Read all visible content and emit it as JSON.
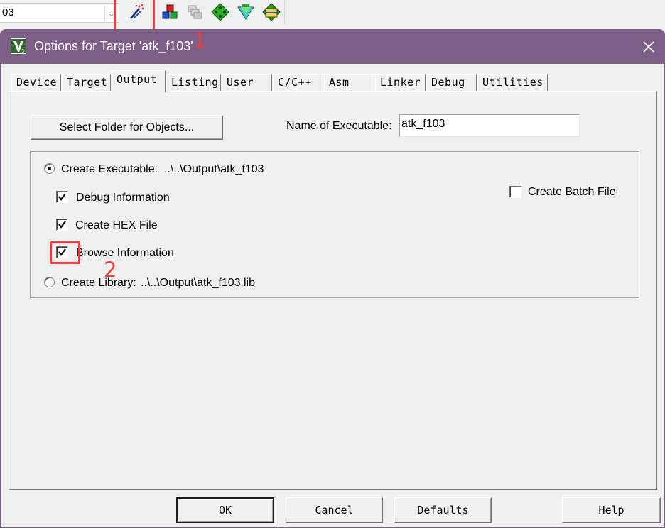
{
  "toolbar": {
    "target_combo_value": "03",
    "annotation_1": "1",
    "icons": [
      "options-for-target-icon",
      "manage-project-items-icon",
      "file-extensions-icon",
      "pack-installer-icon",
      "select-packs-icon",
      "manage-run-time-environment-icon"
    ]
  },
  "dialog": {
    "title": "Options for Target 'atk_f103'",
    "tabs": [
      "Device",
      "Target",
      "Output",
      "Listing",
      "User",
      "C/C++",
      "Asm",
      "Linker",
      "Debug",
      "Utilities"
    ],
    "active_tab": "Output",
    "select_folder_button": "Select Folder for Objects...",
    "name_of_executable_label": "Name of Executable:",
    "name_of_executable_value": "atk_f103",
    "create_executable_label": "Create Executable:",
    "create_executable_path": "..\\..\\Output\\atk_f103",
    "create_executable_selected": true,
    "debug_information_label": "Debug Information",
    "debug_information_checked": true,
    "create_hex_label": "Create HEX File",
    "create_hex_checked": true,
    "browse_information_label": "Browse Information",
    "browse_information_checked": true,
    "create_batch_label": "Create Batch File",
    "create_batch_checked": false,
    "create_library_label": "Create Library:",
    "create_library_path": "..\\..\\Output\\atk_f103.lib",
    "create_library_selected": false,
    "annotation_2": "2",
    "buttons": {
      "ok": "OK",
      "cancel": "Cancel",
      "defaults": "Defaults",
      "help": "Help"
    },
    "colors": {
      "titlebar": "#7c5e86",
      "annotation": "#ef3b3b"
    }
  }
}
